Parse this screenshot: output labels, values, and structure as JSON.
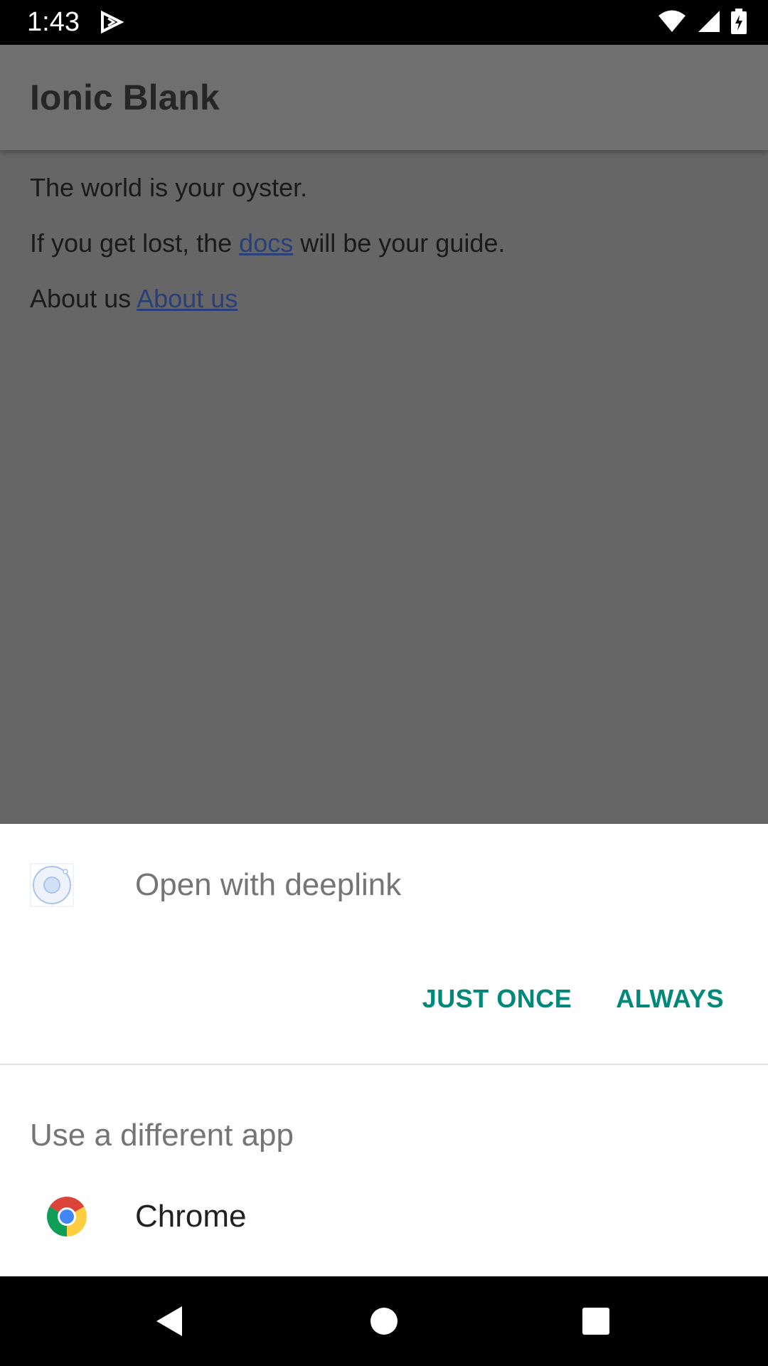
{
  "status_bar": {
    "time": "1:43",
    "notification_icon": "play-store-icon",
    "icons": [
      "wifi-icon",
      "signal-icon",
      "battery-charging-icon"
    ]
  },
  "app": {
    "title": "Ionic Blank",
    "line1": "The world is your oyster.",
    "line2_prefix": "If you get lost, the ",
    "line2_link": "docs",
    "line2_suffix": " will be your guide.",
    "line3_prefix": "About us ",
    "line3_link": "About us"
  },
  "chooser": {
    "title": "Open with deeplink",
    "just_once_label": "JUST ONCE",
    "always_label": "ALWAYS",
    "different_app_label": "Use a different app",
    "apps": [
      {
        "name": "Chrome",
        "icon": "chrome-icon"
      }
    ]
  },
  "nav_bar": {
    "buttons": [
      "back-icon",
      "home-icon",
      "recents-icon"
    ]
  },
  "colors": {
    "scrim": "#666666",
    "accent": "#00897b",
    "link": "#2a3f7a"
  }
}
